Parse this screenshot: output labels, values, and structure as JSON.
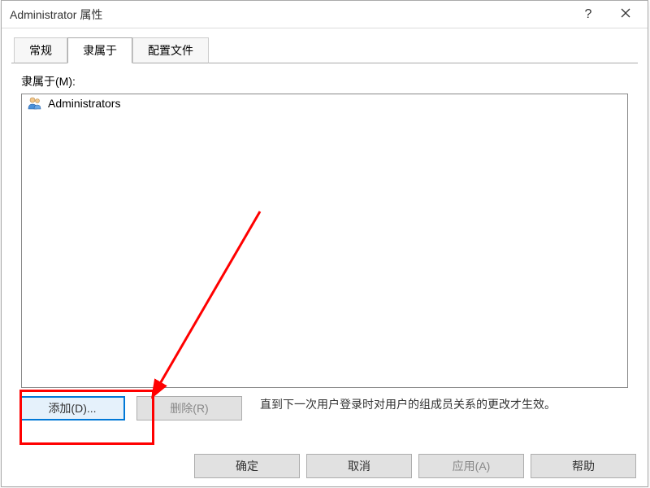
{
  "window": {
    "title": "Administrator 属性"
  },
  "tabs": {
    "general": "常规",
    "member_of": "隶属于",
    "profile": "配置文件"
  },
  "memberof": {
    "label": "隶属于(M):",
    "groups": [
      "Administrators"
    ]
  },
  "buttons": {
    "add": "添加(D)...",
    "remove": "删除(R)"
  },
  "note": "直到下一次用户登录时对用户的组成员关系的更改才生效。",
  "dialog_buttons": {
    "ok": "确定",
    "cancel": "取消",
    "apply": "应用(A)",
    "help": "帮助"
  }
}
